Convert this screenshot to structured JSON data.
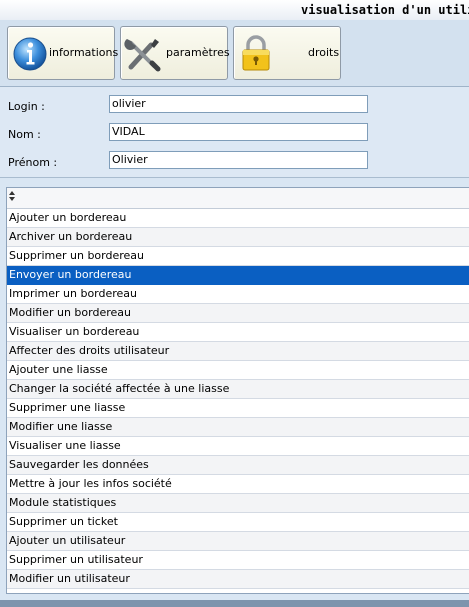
{
  "window": {
    "title": "visualisation d'un utilisateur"
  },
  "toolbar": {
    "informations_label": "informations",
    "parametres_label": "paramètres",
    "droits_label": "droits"
  },
  "form": {
    "login_label": "Login :",
    "login_value": "olivier",
    "nom_label": "Nom :",
    "nom_value": "VIDAL",
    "prenom_label": "Prénom :",
    "prenom_value": "Olivier"
  },
  "rights": {
    "selected_index": 3,
    "items": [
      "Ajouter un bordereau",
      "Archiver un bordereau",
      "Supprimer un bordereau",
      "Envoyer un bordereau",
      "Imprimer un bordereau",
      "Modifier un bordereau",
      "Visualiser un bordereau",
      "Affecter des droits utilisateur",
      "Ajouter une liasse",
      "Changer la société affectée à une liasse",
      "Supprimer une liasse",
      "Modifier une liasse",
      "Visualiser une liasse",
      "Sauvegarder les données",
      "Mettre à jour les infos société",
      "Module statistiques",
      "Supprimer un ticket",
      "Ajouter un utilisateur",
      "Supprimer un utilisateur",
      "Modifier un utilisateur"
    ]
  },
  "colors": {
    "selection": "#0a5fc2",
    "background": "#d9e6f3"
  }
}
